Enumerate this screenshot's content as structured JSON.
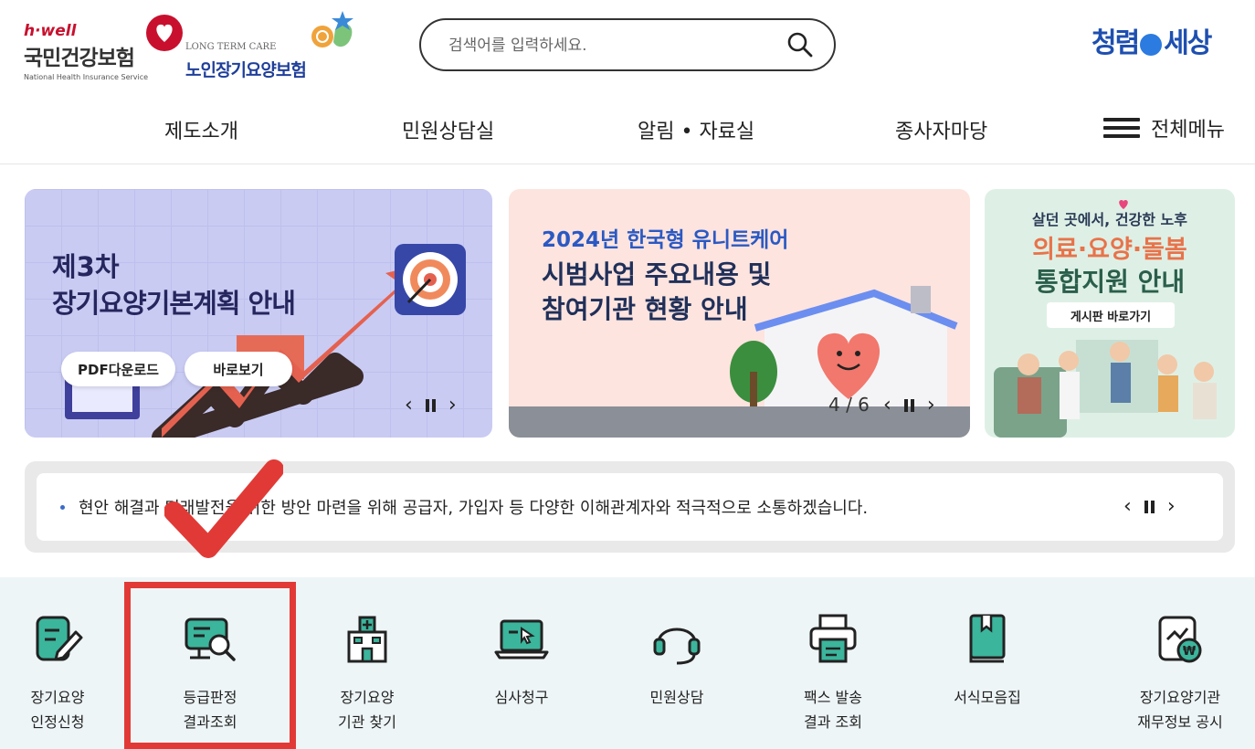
{
  "header": {
    "nhis_logo": {
      "tagline": "h·well",
      "name": "국민건강보험",
      "english": "National Health Insurance Service"
    },
    "ltc_logo": {
      "english": "LONG TERM CARE",
      "name": "노인장기요양보험"
    },
    "search": {
      "placeholder": "검색어를 입력하세요."
    },
    "clean_logo": {
      "left": "청렴",
      "right": "세상"
    }
  },
  "nav": {
    "items": [
      "제도소개",
      "민원상담실",
      "알림 • 자료실",
      "종사자마당"
    ],
    "all_menu": "전체메뉴"
  },
  "banners": {
    "b1": {
      "line1": "제3차",
      "line2": "장기요양기본계획 안내",
      "pdf_button": "PDF다운로드",
      "go_button": "바로보기"
    },
    "b2": {
      "line1": "2024년 한국형 유니트케어",
      "line2": "시범사업 주요내용 및",
      "line3": "참여기관 현황 안내",
      "counter": "4 / 6"
    },
    "b3": {
      "line1": "살던 곳에서, 건강한 노후",
      "line2": "의료·요양·돌봄",
      "line3": "통합지원 안내",
      "board_button": "게시판 바로가기"
    }
  },
  "notice": {
    "text": "현안 해결과 미래발전을 위한 방안 마련을 위해 공급자, 가입자 등 다양한 이해관계자와 적극적으로 소통하겠습니다."
  },
  "quick_menu": [
    {
      "line1": "장기요양",
      "line2": "인정신청",
      "icon": "document-pen-icon"
    },
    {
      "line1": "등급판정",
      "line2": "결과조회",
      "icon": "monitor-search-icon"
    },
    {
      "line1": "장기요양",
      "line2": "기관 찾기",
      "icon": "hospital-icon"
    },
    {
      "line1": "심사청구",
      "line2": "",
      "icon": "laptop-icon"
    },
    {
      "line1": "민원상담",
      "line2": "",
      "icon": "headset-icon"
    },
    {
      "line1": "팩스 발송",
      "line2": "결과 조회",
      "icon": "printer-icon"
    },
    {
      "line1": "서식모음집",
      "line2": "",
      "icon": "book-icon"
    },
    {
      "line1": "장기요양기관",
      "line2": "재무정보 공시",
      "icon": "finance-doc-icon"
    }
  ],
  "colors": {
    "accent_teal": "#3bb59c",
    "annotation_red": "#e13a36",
    "brand_blue": "#1f3f9a"
  }
}
